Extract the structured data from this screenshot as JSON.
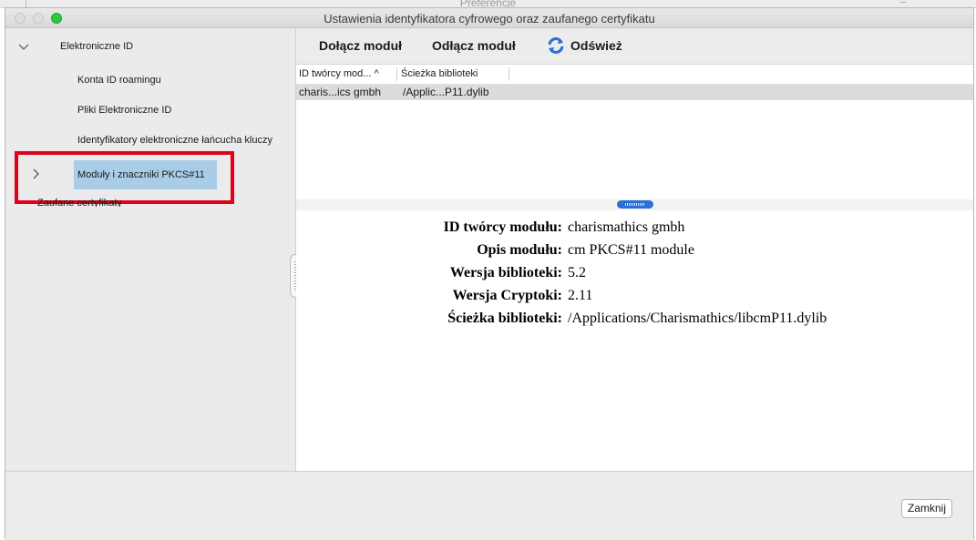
{
  "background_window": {
    "title": "Preferencje"
  },
  "window": {
    "title": "Ustawienia identyfikatora cyfrowego oraz zaufanego certyfikatu"
  },
  "sidebar": {
    "items": [
      {
        "label": "Elektroniczne ID",
        "expanded": true
      },
      {
        "label": "Konta ID roamingu"
      },
      {
        "label": "Pliki Elektroniczne ID"
      },
      {
        "label": "Identyfikatory elektroniczne łańcucha kluczy"
      },
      {
        "label": "Moduły i znaczniki PKCS#11",
        "selected": true,
        "expanded": false
      },
      {
        "label": "Zaufane certyfikaty"
      }
    ]
  },
  "toolbar": {
    "attach_label": "Dołącz moduł",
    "detach_label": "Odłącz moduł",
    "refresh_label": "Odśwież"
  },
  "table": {
    "columns": [
      "ID twórcy mod... ^",
      "Ścieżka biblioteki"
    ],
    "rows": [
      [
        "charis...ics gmbh",
        "/Applic...P11.dylib"
      ]
    ]
  },
  "details": {
    "rows": [
      {
        "label": "ID twórcy modułu:",
        "value": "charismathics gmbh"
      },
      {
        "label": "Opis modułu:",
        "value": "cm PKCS#11 module"
      },
      {
        "label": "Wersja biblioteki:",
        "value": "5.2"
      },
      {
        "label": "Wersja Cryptoki:",
        "value": "2.11"
      },
      {
        "label": "Ścieżka biblioteki:",
        "value": "/Applications/Charismathics/libcmP11.dylib"
      }
    ]
  },
  "footer": {
    "close_label": "Zamknij"
  },
  "colors": {
    "selection": "#a9cde7",
    "highlight_box": "#e3001b",
    "accent": "#2c6ed5"
  }
}
